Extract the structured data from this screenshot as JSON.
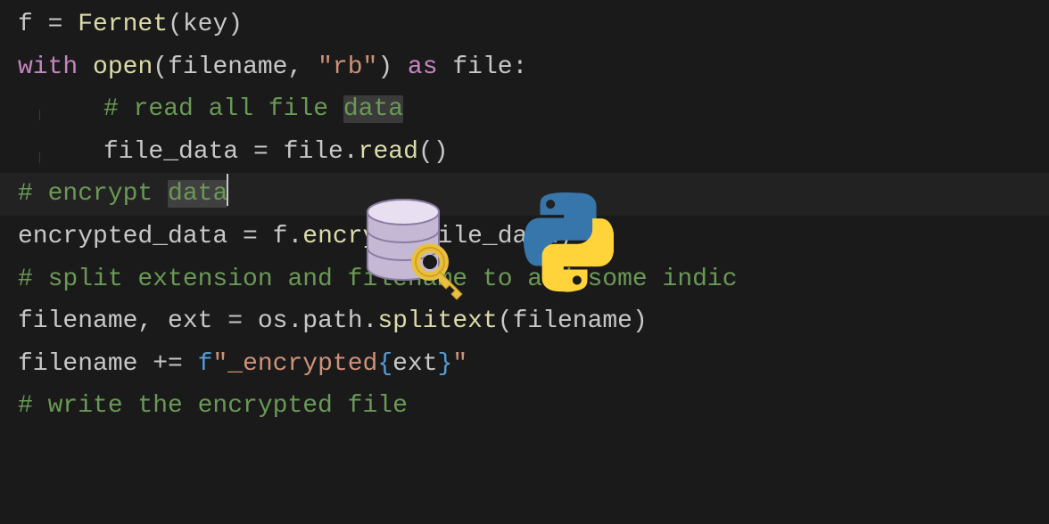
{
  "code": {
    "line1": {
      "t1": "f ",
      "t2": "=",
      "t3": " Fernet",
      "t4": "(",
      "t5": "key",
      "t6": ")"
    },
    "line2": {
      "t1": "with",
      "t2": " ",
      "t3": "open",
      "t4": "(",
      "t5": "filename",
      "t6": ", ",
      "t7": "\"rb\"",
      "t8": ") ",
      "t9": "as",
      "t10": " file:"
    },
    "line3": {
      "t1": "# read all file ",
      "t2": "data"
    },
    "line4": {
      "t1": "file_data ",
      "t2": "=",
      "t3": " file",
      "t4": ".",
      "t5": "read",
      "t6": "()"
    },
    "line5": {
      "t1": "# encrypt ",
      "t2": "data"
    },
    "line6": {
      "t1": "encrypted_data ",
      "t2": "=",
      "t3": " f",
      "t4": ".",
      "t5": "encrypt",
      "t6": "(",
      "t7": "file_data",
      "t8": ")"
    },
    "line7": {
      "t1": "# split extension and filename to add some indic"
    },
    "line8": {
      "t1": "filename, ext ",
      "t2": "=",
      "t3": " os",
      "t4": ".",
      "t5": "path",
      "t6": ".",
      "t7": "splitext",
      "t8": "(",
      "t9": "filename",
      "t10": ")"
    },
    "line9": {
      "t1": "filename ",
      "t2": "+=",
      "t3": " ",
      "t4": "f",
      "t5": "\"_encrypted",
      "t6": "{",
      "t7": "ext",
      "t8": "}",
      "t9": "\""
    },
    "line10": {
      "t1": "# write the encrypted file"
    }
  },
  "icons": {
    "database": "database-icon",
    "key": "key-icon",
    "python": "python-icon"
  }
}
